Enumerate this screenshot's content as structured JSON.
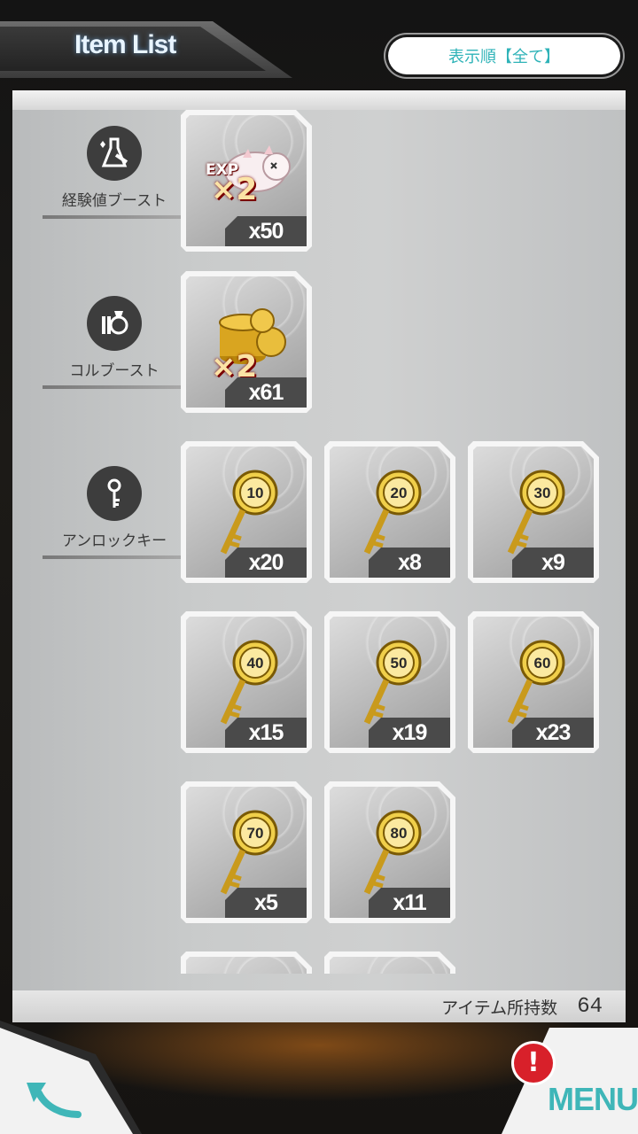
{
  "header": {
    "title": "Item List",
    "sort_button_label": "表示順【全て】"
  },
  "categories": [
    {
      "label": "経験値ブースト",
      "icon": "exp-boost-icon"
    },
    {
      "label": "コルブースト",
      "icon": "col-boost-icon"
    },
    {
      "label": "アンロックキー",
      "icon": "key-icon"
    }
  ],
  "items": {
    "exp_boost": {
      "badge": "EXP",
      "multiplier": "×2",
      "count": "x50"
    },
    "col_boost": {
      "multiplier": "×2",
      "count": "x61"
    },
    "keys": [
      {
        "number": "10",
        "count": "x20"
      },
      {
        "number": "20",
        "count": "x8"
      },
      {
        "number": "30",
        "count": "x9"
      },
      {
        "number": "40",
        "count": "x15"
      },
      {
        "number": "50",
        "count": "x19"
      },
      {
        "number": "60",
        "count": "x23"
      },
      {
        "number": "70",
        "count": "x5"
      },
      {
        "number": "80",
        "count": "x11"
      }
    ]
  },
  "footer": {
    "owned_label": "アイテム所持数",
    "owned_value": "64"
  },
  "nav": {
    "back_icon": "back-arrow-icon",
    "menu_label": "MENU",
    "alert_badge": "!"
  },
  "colors": {
    "accent": "#3fb6b8",
    "alert": "#d8202a",
    "gold": "#d9b22a"
  }
}
